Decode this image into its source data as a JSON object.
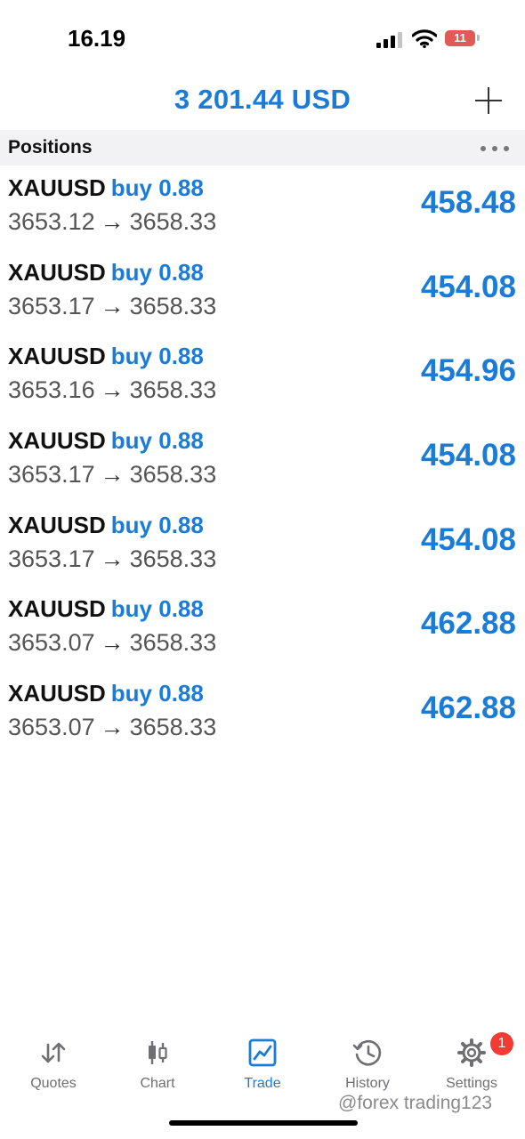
{
  "status_bar": {
    "time": "16.19",
    "battery": "11"
  },
  "header": {
    "balance": "3 201.44 USD"
  },
  "section": {
    "title": "Positions"
  },
  "positions": [
    {
      "symbol": "XAUUSD",
      "type": "buy 0.88",
      "open": "3653.12",
      "arrow": "→",
      "current": "3658.33",
      "profit": "458.48"
    },
    {
      "symbol": "XAUUSD",
      "type": "buy 0.88",
      "open": "3653.17",
      "arrow": "→",
      "current": "3658.33",
      "profit": "454.08"
    },
    {
      "symbol": "XAUUSD",
      "type": "buy 0.88",
      "open": "3653.16",
      "arrow": "→",
      "current": "3658.33",
      "profit": "454.96"
    },
    {
      "symbol": "XAUUSD",
      "type": "buy 0.88",
      "open": "3653.17",
      "arrow": "→",
      "current": "3658.33",
      "profit": "454.08"
    },
    {
      "symbol": "XAUUSD",
      "type": "buy 0.88",
      "open": "3653.17",
      "arrow": "→",
      "current": "3658.33",
      "profit": "454.08"
    },
    {
      "symbol": "XAUUSD",
      "type": "buy 0.88",
      "open": "3653.07",
      "arrow": "→",
      "current": "3658.33",
      "profit": "462.88"
    },
    {
      "symbol": "XAUUSD",
      "type": "buy 0.88",
      "open": "3653.07",
      "arrow": "→",
      "current": "3658.33",
      "profit": "462.88"
    }
  ],
  "tabs": [
    {
      "label": "Quotes",
      "icon": "quotes-sort-arrows-icon"
    },
    {
      "label": "Chart",
      "icon": "candlestick-chart-icon"
    },
    {
      "label": "Trade",
      "icon": "trade-line-chart-icon",
      "active": true
    },
    {
      "label": "History",
      "icon": "history-clock-icon"
    },
    {
      "label": "Settings",
      "icon": "gear-icon",
      "badge": "1"
    }
  ],
  "watermark": "@forex trading123",
  "colors": {
    "accent": "#1a7cd6",
    "badge": "#f23b33",
    "section_bg": "#f2f2f4"
  }
}
